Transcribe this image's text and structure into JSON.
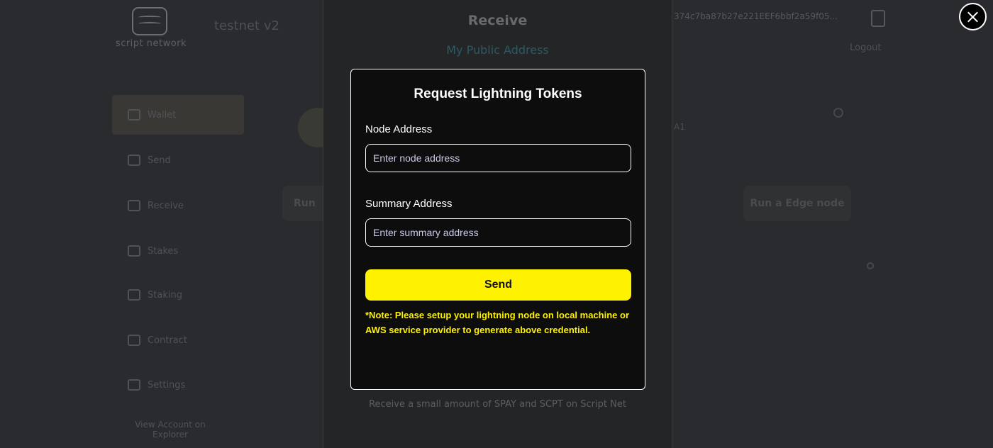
{
  "background": {
    "logo_text": "script network",
    "network_name": "testnet v2",
    "address_snippet": "374c7ba87b27e221EEF6bbf2a59f05...",
    "logout": "Logout",
    "sidebar": {
      "items": [
        {
          "label": "Wallet",
          "icon": "wallet-icon"
        },
        {
          "label": "Send",
          "icon": "send-icon"
        },
        {
          "label": "Receive",
          "icon": "receive-icon"
        },
        {
          "label": "Stakes",
          "icon": "stakes-icon"
        },
        {
          "label": "Staking",
          "icon": "staking-icon"
        },
        {
          "label": "Contract",
          "icon": "contract-icon"
        },
        {
          "label": "Settings",
          "icon": "settings-icon"
        },
        {
          "label": "View Account on Explorer",
          "icon": "explorer-icon"
        }
      ]
    },
    "run_left": "Run",
    "run_edge_node": "Run a Edge node",
    "faint_label": "A1"
  },
  "receive_panel": {
    "title": "Receive",
    "subtitle": "My Public Address",
    "footer": "Receive a small amount of SPAY and SCPT on Script Net"
  },
  "modal": {
    "title": "Request Lightning Tokens",
    "node_address": {
      "label": "Node Address",
      "placeholder": "Enter node address",
      "value": ""
    },
    "summary_address": {
      "label": "Summary Address",
      "placeholder": "Enter summary address",
      "value": ""
    },
    "send_label": "Send",
    "note": "*Note: Please setup your lightning node on local machine or AWS service provider to generate above credential."
  },
  "colors": {
    "accent": "#fff200",
    "modal_bg": "#0d0d0d",
    "page_bg": "#2a2b2e"
  }
}
